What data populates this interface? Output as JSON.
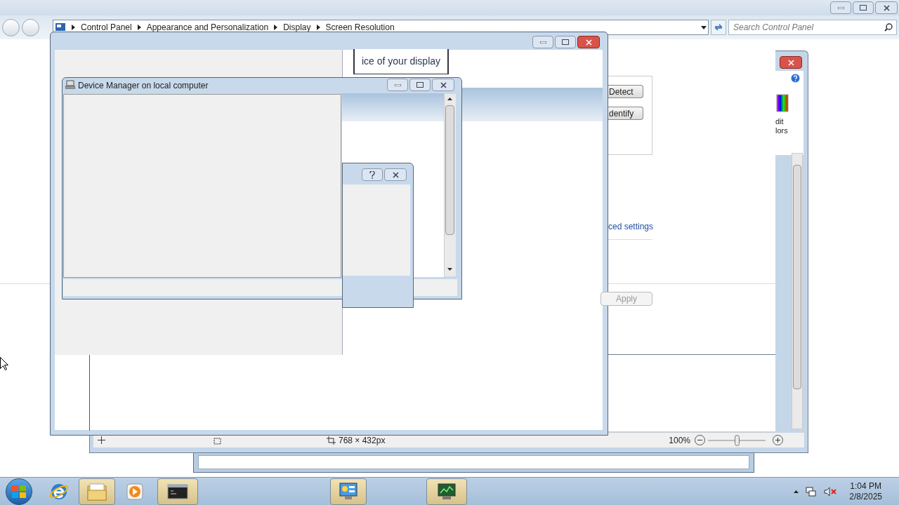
{
  "explorer": {
    "breadcrumb": [
      "Control Panel",
      "Appearance and Personalization",
      "Display",
      "Screen Resolution"
    ],
    "search": {
      "placeholder": "Search Control Panel"
    }
  },
  "resolution": {
    "partial_text": "ice of your display",
    "buttons": [
      {
        "label": "Detect"
      },
      {
        "label": "dentify"
      }
    ],
    "link": "ced settings",
    "apply": {
      "label": "Apply",
      "disabled": true
    }
  },
  "side_window": {
    "lines": [
      "dit",
      "lors"
    ]
  },
  "image_viewer": {
    "size": "768 × 432px",
    "zoom": "100%",
    "zoom_slider": {
      "level": 0.5
    }
  },
  "device_manager": {
    "title": "Device Manager on local computer"
  },
  "taskbar": {
    "apps": [
      {
        "kind": "ie",
        "highlighted": false
      },
      {
        "kind": "folder",
        "highlighted": true
      },
      {
        "kind": "media",
        "highlighted": false
      },
      {
        "kind": "cmd",
        "highlighted": true
      },
      {
        "kind": "control",
        "highlighted": true
      },
      {
        "kind": "monitor",
        "highlighted": true
      }
    ],
    "time": "1:04 PM",
    "date": "2/8/2025"
  }
}
